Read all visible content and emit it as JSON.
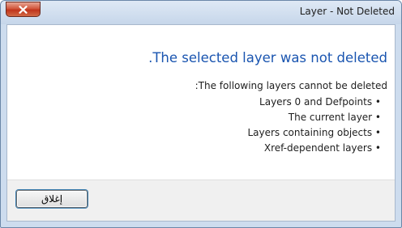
{
  "window": {
    "title": "Layer - Not Deleted"
  },
  "titlebar": {
    "close_icon": "close-icon",
    "close_color": "#c63f24"
  },
  "message": {
    "heading": ".The selected layer was not deleted",
    "intro": ":The following layers cannot be deleted",
    "items": [
      "Layers 0 and Defpoints •",
      "The current layer •",
      "Layers containing objects •",
      "Xref-dependent layers •"
    ]
  },
  "footer": {
    "close_label": "إغلاق"
  },
  "colors": {
    "heading": "#1a55b0",
    "frame": "#cddcee"
  }
}
